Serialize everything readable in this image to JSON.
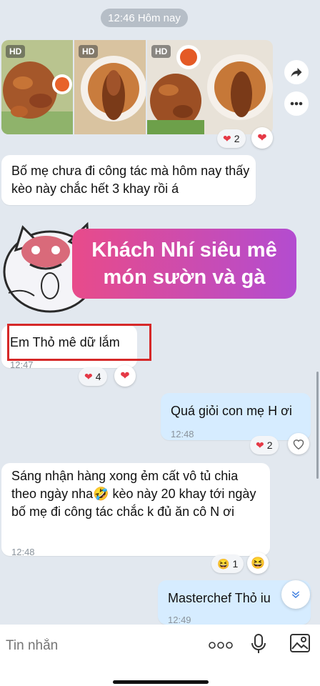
{
  "date_pill": "12:46 Hôm nay",
  "photos": {
    "hd_label": "HD",
    "reaction_count": "2"
  },
  "messages": [
    {
      "text": "Bố mẹ chưa đi công tác mà hôm nay thấy kèo này chắc hết 3 khay rồi á"
    },
    {
      "sticker_text_line1": "Khách Nhí siêu mê",
      "sticker_text_line2": "món sườn và gà"
    },
    {
      "text": "Em Thỏ mê dữ lắm",
      "time": "12:47",
      "reaction_count": "4"
    },
    {
      "text": "Quá giỏi con mẹ H ơi",
      "time": "12:48",
      "reaction_count": "2"
    },
    {
      "text": "Sáng nhận hàng xong ẻm cất vô tủ chia theo ngày nha🤣 kèo này 20 khay tới ngày bố mẹ đi công tác chắc k đủ ăn cô N ơi",
      "time": "12:48",
      "reaction_count": "1"
    },
    {
      "text": "Masterchef Thỏ iu",
      "time": "12:49"
    }
  ],
  "input": {
    "placeholder": "Tin nhắn"
  },
  "colors": {
    "accent": "#e94b7a",
    "outgoing_bubble": "#d6ecff",
    "background": "#e2e8ef",
    "highlight_box": "#d62828"
  }
}
